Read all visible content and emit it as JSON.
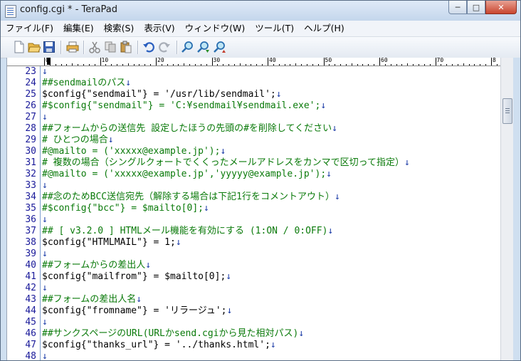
{
  "window": {
    "title": "config.cgi * - TeraPad"
  },
  "window_buttons": {
    "minimize": "─",
    "maximize": "□",
    "close": "✕"
  },
  "menu": {
    "items": [
      "ファイル(F)",
      "編集(E)",
      "検索(S)",
      "表示(V)",
      "ウィンドウ(W)",
      "ツール(T)",
      "ヘルプ(H)"
    ]
  },
  "toolbar": {
    "buttons": [
      "new-file-icon",
      "open-folder-icon",
      "save-icon",
      "print-icon",
      "cut-icon",
      "copy-icon",
      "paste-icon",
      "undo-icon",
      "redo-icon",
      "find-icon",
      "find-next-icon",
      "find-prev-icon"
    ]
  },
  "ruler": {
    "labels": [
      "0",
      "10",
      "20",
      "30",
      "40",
      "50",
      "60",
      "70",
      "8"
    ]
  },
  "editor": {
    "newline_mark": "↓",
    "lines": [
      {
        "num": "23",
        "text": "",
        "comment": false
      },
      {
        "num": "24",
        "text": "##sendmailのパス",
        "comment": true
      },
      {
        "num": "25",
        "text": "$config{\"sendmail\"} = '/usr/lib/sendmail';",
        "comment": false
      },
      {
        "num": "26",
        "text": "#$config{\"sendmail\"} = 'C:¥sendmail¥sendmail.exe';",
        "comment": true
      },
      {
        "num": "27",
        "text": "",
        "comment": false
      },
      {
        "num": "28",
        "text": "##フォームからの送信先 設定したほうの先頭の#を削除してください",
        "comment": true
      },
      {
        "num": "29",
        "text": "# ひとつの場合",
        "comment": true
      },
      {
        "num": "30",
        "text": "#@mailto = ('xxxxx@example.jp');",
        "comment": true
      },
      {
        "num": "31",
        "text": "# 複数の場合（シングルクォートでくくったメールアドレスをカンマで区切って指定）",
        "comment": true
      },
      {
        "num": "32",
        "text": "#@mailto = ('xxxxx@example.jp','yyyyy@example.jp');",
        "comment": true
      },
      {
        "num": "33",
        "text": "",
        "comment": false
      },
      {
        "num": "34",
        "text": "##念のためBCC送信宛先（解除する場合は下記1行をコメントアウト）",
        "comment": true
      },
      {
        "num": "35",
        "text": "#$config{\"bcc\"} = $mailto[0];",
        "comment": true
      },
      {
        "num": "36",
        "text": "",
        "comment": false
      },
      {
        "num": "37",
        "text": "## [ v3.2.0 ] HTMLメール機能を有効にする (1:ON / 0:OFF)",
        "comment": true
      },
      {
        "num": "38",
        "text": "$config{\"HTMLMAIL\"} = 1;",
        "comment": false
      },
      {
        "num": "39",
        "text": "",
        "comment": false
      },
      {
        "num": "40",
        "text": "##フォームからの差出人",
        "comment": true
      },
      {
        "num": "41",
        "text": "$config{\"mailfrom\"} = $mailto[0];",
        "comment": false
      },
      {
        "num": "42",
        "text": "",
        "comment": false
      },
      {
        "num": "43",
        "text": "##フォームの差出人名",
        "comment": true
      },
      {
        "num": "44",
        "text": "$config{\"fromname\"} = 'リラージュ';",
        "comment": false
      },
      {
        "num": "45",
        "text": "",
        "comment": false
      },
      {
        "num": "46",
        "text": "##サンクスページのURL(URLかsend.cgiから見た相対パス)",
        "comment": true
      },
      {
        "num": "47",
        "text": "$config{\"thanks_url\"} = '../thanks.html';",
        "comment": false
      },
      {
        "num": "48",
        "text": "",
        "comment": false
      }
    ]
  },
  "colors": {
    "comment": "#0a7a0a",
    "code": "#000000",
    "line_number": "#1a1a9a",
    "newline_mark": "#1a3aa6"
  }
}
